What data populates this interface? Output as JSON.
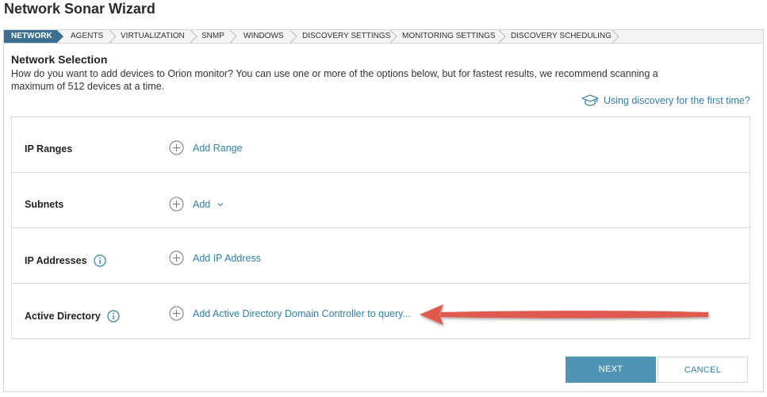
{
  "wizard": {
    "title": "Network Sonar Wizard"
  },
  "steps": [
    {
      "label": "NETWORK",
      "active": true
    },
    {
      "label": "AGENTS"
    },
    {
      "label": "VIRTUALIZATION"
    },
    {
      "label": "SNMP"
    },
    {
      "label": "WINDOWS"
    },
    {
      "label": "DISCOVERY SETTINGS"
    },
    {
      "label": "MONITORING SETTINGS"
    },
    {
      "label": "DISCOVERY SCHEDULING"
    }
  ],
  "section": {
    "heading": "Network Selection",
    "description": "How do you want to add devices to Orion monitor? You can use one or more of the options below, but for fastest results, we recommend scanning a maximum of 512 devices at a time.",
    "help_link": "Using discovery for the first time?"
  },
  "rows": [
    {
      "label": "IP Ranges",
      "action": "Add Range"
    },
    {
      "label": "Subnets",
      "action": "Add"
    },
    {
      "label": "IP Addresses",
      "action": "Add IP Address"
    },
    {
      "label": "Active Directory",
      "action": "Add Active Directory Domain Controller to query..."
    }
  ],
  "footer": {
    "next": "NEXT",
    "cancel": "CANCEL"
  },
  "colors": {
    "accent": "#4f94b4",
    "active_step": "#3b6f8f",
    "link": "#2f7fa5",
    "annotation_arrow": "#e05a4f"
  }
}
